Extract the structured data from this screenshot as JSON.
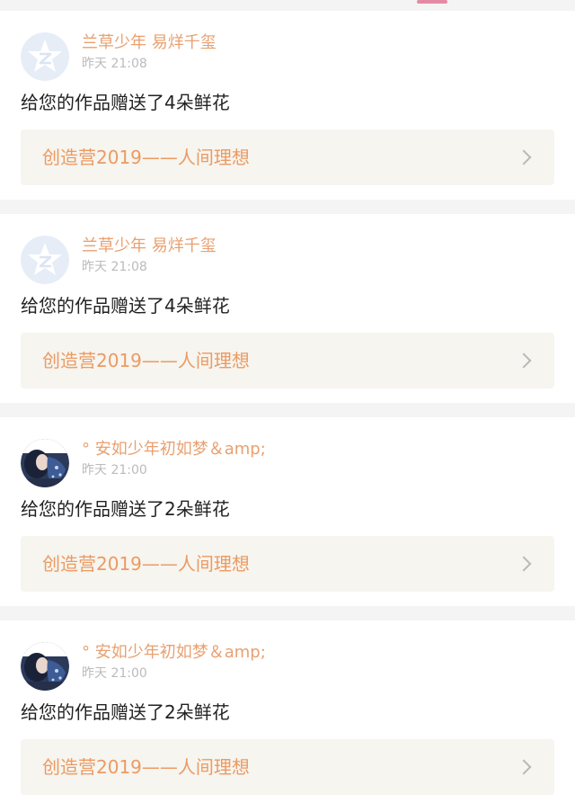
{
  "notifications": [
    {
      "avatar": "qzone-default-avatar",
      "user_name": "兰草少年 易烊千玺",
      "time": "昨天 21:08",
      "message": "给您的作品赠送了4朵鲜花",
      "work_title": "创造营2019——人间理想"
    },
    {
      "avatar": "qzone-default-avatar",
      "user_name": "兰草少年 易烊千玺",
      "time": "昨天 21:08",
      "message": "给您的作品赠送了4朵鲜花",
      "work_title": "创造营2019——人间理想"
    },
    {
      "avatar": "photo-avatar",
      "user_name": "° 安如少年初如梦＆amp;",
      "time": "昨天 21:00",
      "message": "给您的作品赠送了2朵鲜花",
      "work_title": "创造营2019——人间理想"
    },
    {
      "avatar": "photo-avatar",
      "user_name": "° 安如少年初如梦＆amp;",
      "time": "昨天 21:00",
      "message": "给您的作品赠送了2朵鲜花",
      "work_title": "创造营2019——人间理想"
    }
  ],
  "colors": {
    "user_name": "#e8a070",
    "work_title": "#ec9a63",
    "work_bg": "#f6f5ef",
    "tab_indicator": "#e58aa6"
  }
}
